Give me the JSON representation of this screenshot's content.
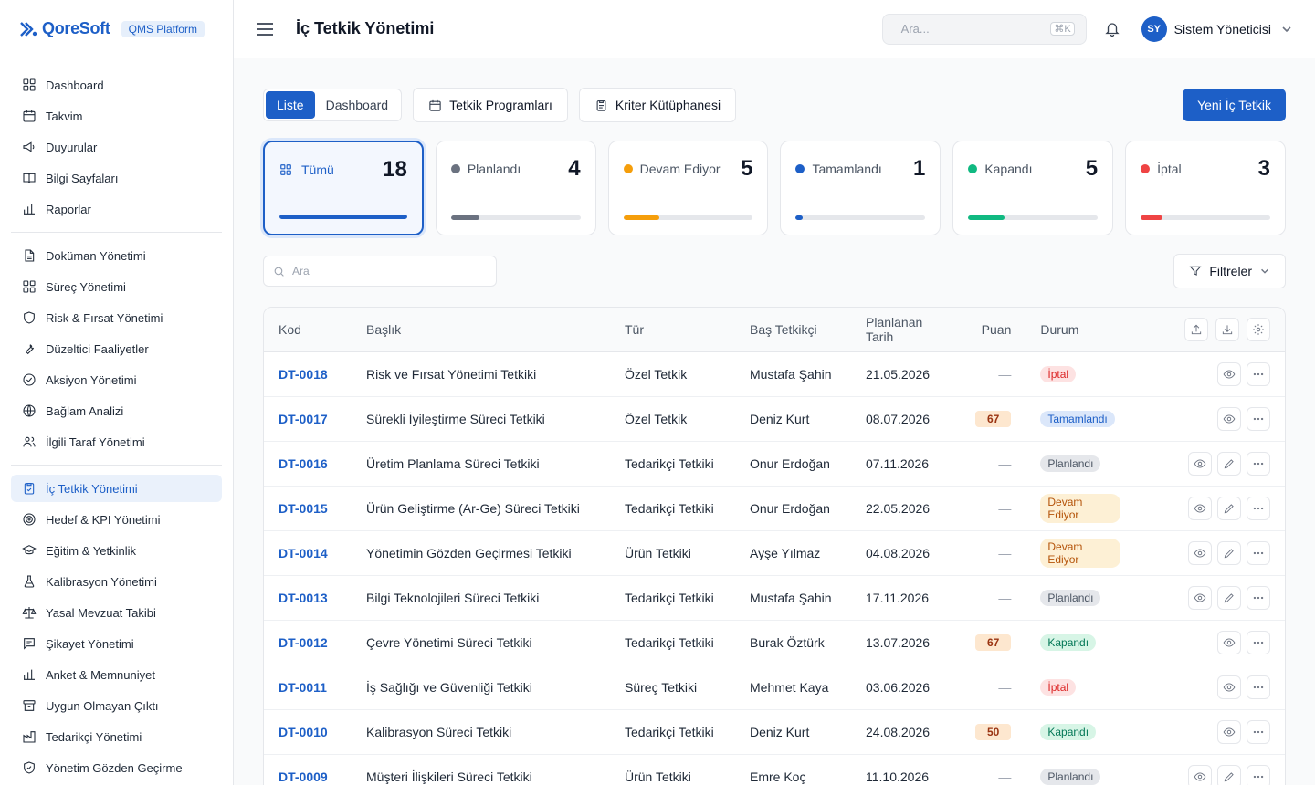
{
  "brand": {
    "name": "QoreSoft",
    "platform": "QMS Platform"
  },
  "sidebar": {
    "groups": [
      [
        {
          "label": "Dashboard",
          "icon": "grid-icon"
        },
        {
          "label": "Takvim",
          "icon": "calendar-icon"
        },
        {
          "label": "Duyurular",
          "icon": "megaphone-icon"
        },
        {
          "label": "Bilgi Sayfaları",
          "icon": "book-icon"
        },
        {
          "label": "Raporlar",
          "icon": "bar-chart-icon"
        }
      ],
      [
        {
          "label": "Doküman Yönetimi",
          "icon": "document-icon"
        },
        {
          "label": "Süreç Yönetimi",
          "icon": "grid-icon"
        },
        {
          "label": "Risk & Fırsat Yönetimi",
          "icon": "shield-icon"
        },
        {
          "label": "Düzeltici Faaliyetler",
          "icon": "wrench-icon"
        },
        {
          "label": "Aksiyon Yönetimi",
          "icon": "check-circle-icon"
        },
        {
          "label": "Bağlam Analizi",
          "icon": "globe-icon"
        },
        {
          "label": "İlgili Taraf Yönetimi",
          "icon": "users-icon"
        }
      ],
      [
        {
          "label": "İç Tetkik Yönetimi",
          "icon": "clipboard-check-icon",
          "active": true
        },
        {
          "label": "Hedef & KPI Yönetimi",
          "icon": "target-icon"
        },
        {
          "label": "Eğitim & Yetkinlik",
          "icon": "graduation-cap-icon"
        },
        {
          "label": "Kalibrasyon Yönetimi",
          "icon": "flask-icon"
        },
        {
          "label": "Yasal Mevzuat Takibi",
          "icon": "scale-icon"
        },
        {
          "label": "Şikayet Yönetimi",
          "icon": "message-icon"
        },
        {
          "label": "Anket & Memnuniyet",
          "icon": "bar-chart-icon"
        },
        {
          "label": "Uygun Olmayan Çıktı",
          "icon": "archive-icon"
        },
        {
          "label": "Tedarikçi Yönetimi",
          "icon": "factory-icon"
        },
        {
          "label": "Yönetim Gözden Geçirme",
          "icon": "shield-check-icon"
        }
      ]
    ]
  },
  "header": {
    "title": "İç Tetkik Yönetimi",
    "search_placeholder": "Ara...",
    "shortcut": "⌘K",
    "user_initials": "SY",
    "user_name": "Sistem Yöneticisi"
  },
  "toolbar": {
    "view_list": "Liste",
    "view_dashboard": "Dashboard",
    "programs": "Tetkik Programları",
    "criteria": "Kriter Kütüphanesi",
    "new_audit": "Yeni İç Tetkik"
  },
  "stats": [
    {
      "label": "Tümü",
      "count": "18",
      "fraction": 1.0,
      "color": "#1d5fc7",
      "active": true
    },
    {
      "label": "Planlandı",
      "count": "4",
      "fraction": 0.222,
      "color": "#6b7280"
    },
    {
      "label": "Devam Ediyor",
      "count": "5",
      "fraction": 0.278,
      "color": "#f59e0b"
    },
    {
      "label": "Tamamlandı",
      "count": "1",
      "fraction": 0.056,
      "color": "#1d5fc7"
    },
    {
      "label": "Kapandı",
      "count": "5",
      "fraction": 0.278,
      "color": "#10b981"
    },
    {
      "label": "İptal",
      "count": "3",
      "fraction": 0.167,
      "color": "#ef4444"
    }
  ],
  "filters": {
    "search_placeholder": "Ara",
    "filter_label": "Filtreler"
  },
  "table": {
    "columns": [
      "Kod",
      "Başlık",
      "Tür",
      "Baş Tetkikçi",
      "Planlanan Tarih",
      "Puan",
      "Durum"
    ],
    "rows": [
      {
        "code": "DT-0018",
        "title": "Risk ve Fırsat Yönetimi Tetkiki",
        "type": "Özel Tetkik",
        "lead": "Mustafa Şahin",
        "date": "21.05.2026",
        "score": "—",
        "status": "İptal",
        "status_key": "cancel",
        "editable": false
      },
      {
        "code": "DT-0017",
        "title": "Sürekli İyileştirme Süreci Tetkiki",
        "type": "Özel Tetkik",
        "lead": "Deniz Kurt",
        "date": "08.07.2026",
        "score": "67",
        "status": "Tamamlandı",
        "status_key": "done",
        "editable": false
      },
      {
        "code": "DT-0016",
        "title": "Üretim Planlama Süreci Tetkiki",
        "type": "Tedarikçi Tetkiki",
        "lead": "Onur Erdoğan",
        "date": "07.11.2026",
        "score": "—",
        "status": "Planlandı",
        "status_key": "planned",
        "editable": true
      },
      {
        "code": "DT-0015",
        "title": "Ürün Geliştirme (Ar-Ge) Süreci Tetkiki",
        "type": "Tedarikçi Tetkiki",
        "lead": "Onur Erdoğan",
        "date": "22.05.2026",
        "score": "—",
        "status": "Devam Ediyor",
        "status_key": "progress",
        "editable": true
      },
      {
        "code": "DT-0014",
        "title": "Yönetimin Gözden Geçirmesi Tetkiki",
        "type": "Ürün Tetkiki",
        "lead": "Ayşe Yılmaz",
        "date": "04.08.2026",
        "score": "—",
        "status": "Devam Ediyor",
        "status_key": "progress",
        "editable": true
      },
      {
        "code": "DT-0013",
        "title": "Bilgi Teknolojileri Süreci Tetkiki",
        "type": "Tedarikçi Tetkiki",
        "lead": "Mustafa Şahin",
        "date": "17.11.2026",
        "score": "—",
        "status": "Planlandı",
        "status_key": "planned",
        "editable": true
      },
      {
        "code": "DT-0012",
        "title": "Çevre Yönetimi Süreci Tetkiki",
        "type": "Tedarikçi Tetkiki",
        "lead": "Burak Öztürk",
        "date": "13.07.2026",
        "score": "67",
        "status": "Kapandı",
        "status_key": "closed",
        "editable": false
      },
      {
        "code": "DT-0011",
        "title": "İş Sağlığı ve Güvenliği Tetkiki",
        "type": "Süreç Tetkiki",
        "lead": "Mehmet Kaya",
        "date": "03.06.2026",
        "score": "—",
        "status": "İptal",
        "status_key": "cancel",
        "editable": false
      },
      {
        "code": "DT-0010",
        "title": "Kalibrasyon Süreci Tetkiki",
        "type": "Tedarikçi Tetkiki",
        "lead": "Deniz Kurt",
        "date": "24.08.2026",
        "score": "50",
        "status": "Kapandı",
        "status_key": "closed",
        "editable": false
      },
      {
        "code": "DT-0009",
        "title": "Müşteri İlişkileri Süreci Tetkiki",
        "type": "Ürün Tetkiki",
        "lead": "Emre Koç",
        "date": "11.10.2026",
        "score": "—",
        "status": "Planlandı",
        "status_key": "planned",
        "editable": true
      }
    ]
  },
  "status_colors": {
    "cancel": {
      "bg": "#fde2e2",
      "fg": "#dc2626"
    },
    "done": {
      "bg": "#dbe7fa",
      "fg": "#1d5fc7"
    },
    "planned": {
      "bg": "#e5e7eb",
      "fg": "#4b5563"
    },
    "progress": {
      "bg": "#fdf0d5",
      "fg": "#b45309"
    },
    "closed": {
      "bg": "#d7f5e6",
      "fg": "#047857"
    }
  }
}
